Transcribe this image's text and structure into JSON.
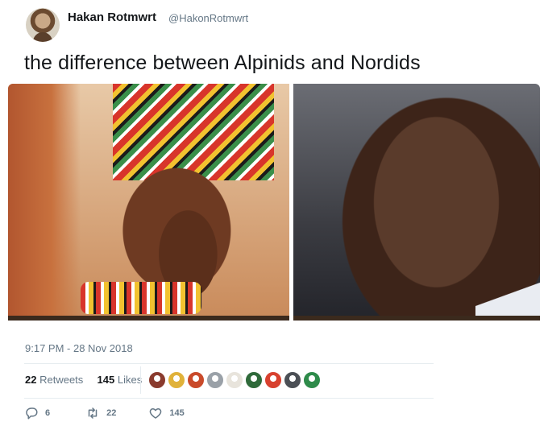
{
  "user": {
    "name": "Hakan Rotmwrt",
    "handle": "@HakonRotmwrt"
  },
  "tweet": {
    "text": "the difference between Alpinids and Nordids",
    "timestamp": "9:17 PM - 28 Nov 2018"
  },
  "stats": {
    "retweets_count": "22",
    "retweets_label": "Retweets",
    "likes_count": "145",
    "likes_label": "Likes"
  },
  "actions": {
    "reply_count": "6",
    "retweet_count": "22",
    "like_count": "145"
  },
  "colors": {
    "text_primary": "#14171a",
    "text_secondary": "#657786",
    "divider": "#e6ecf0",
    "liker_avatars": [
      "#8a3b2e",
      "#e0b23a",
      "#c94a2a",
      "#9aa1a8",
      "#e8e4dc",
      "#2f6a3a",
      "#d8412f",
      "#4b4f55",
      "#2e8b4a"
    ]
  },
  "icons": {
    "reply": "reply-icon",
    "retweet": "retweet-icon",
    "like": "heart-icon"
  }
}
